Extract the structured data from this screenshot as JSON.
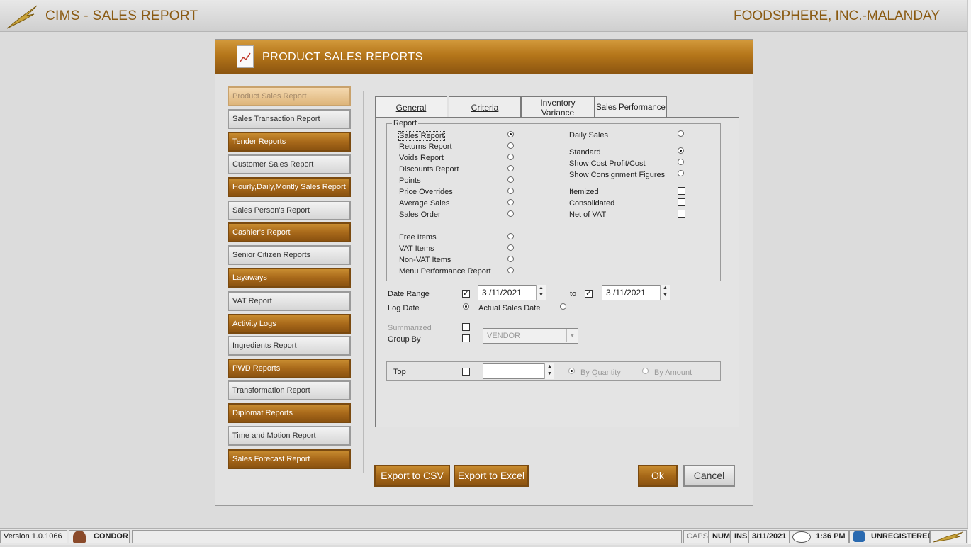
{
  "app": {
    "title": "CIMS - SALES REPORT",
    "company": "FOODSPHERE, INC.-MALANDAY"
  },
  "panel": {
    "title": "PRODUCT SALES REPORTS"
  },
  "sidebar": {
    "items": [
      {
        "label": "Product Sales Report"
      },
      {
        "label": "Sales Transaction Report"
      },
      {
        "label": "Tender Reports"
      },
      {
        "label": "Customer Sales Report"
      },
      {
        "label": "Hourly,Daily,Montly Sales Report"
      },
      {
        "label": "Sales Person's Report"
      },
      {
        "label": "Cashier's Report"
      },
      {
        "label": "Senior Citizen Reports"
      },
      {
        "label": "Layaways"
      },
      {
        "label": "VAT Report"
      },
      {
        "label": "Activity Logs"
      },
      {
        "label": "Ingredients Report"
      },
      {
        "label": "PWD Reports"
      },
      {
        "label": "Transformation Report"
      },
      {
        "label": "Diplomat Reports"
      },
      {
        "label": "Time and Motion Report"
      },
      {
        "label": "Sales Forecast Report"
      }
    ]
  },
  "tabs": [
    {
      "label": "General"
    },
    {
      "label": "Criteria"
    },
    {
      "label": "Inventory Variance"
    },
    {
      "label": "Sales Performance"
    }
  ],
  "general": {
    "group_label": "Report",
    "left_options": [
      {
        "label": "Sales Report",
        "selected": true
      },
      {
        "label": "Returns Report",
        "selected": false
      },
      {
        "label": "Voids Report",
        "selected": false
      },
      {
        "label": "Discounts Report",
        "selected": false
      },
      {
        "label": "Points",
        "selected": false
      },
      {
        "label": "Price Overrides",
        "selected": false
      },
      {
        "label": "Average Sales",
        "selected": false
      },
      {
        "label": "Sales Order",
        "selected": false
      },
      {
        "label": "Free Items",
        "selected": false
      },
      {
        "label": "VAT Items",
        "selected": false
      },
      {
        "label": "Non-VAT Items",
        "selected": false
      },
      {
        "label": "Menu Performance Report",
        "selected": false
      }
    ],
    "daily_sales": {
      "label": "Daily Sales",
      "selected": false
    },
    "view_options": [
      {
        "label": "Standard",
        "selected": true
      },
      {
        "label": "Show Cost Profit/Cost",
        "selected": false
      },
      {
        "label": "Show Consignment Figures",
        "selected": false
      }
    ],
    "check_options": [
      {
        "label": "Itemized",
        "checked": false
      },
      {
        "label": "Consolidated",
        "checked": false
      },
      {
        "label": "Net of VAT",
        "checked": false
      }
    ],
    "date_range": {
      "label": "Date Range",
      "from_checked": true,
      "from_value": "3 /11/2021",
      "to_label": "to",
      "to_checked": true,
      "to_value": "3 /11/2021"
    },
    "log_date": {
      "label": "Log Date",
      "selected": true
    },
    "actual_sales_date": {
      "label": "Actual Sales Date",
      "selected": false
    },
    "summarized": {
      "label": "Summarized",
      "checked": false
    },
    "group_by": {
      "label": "Group By",
      "checked": false,
      "value": "VENDOR"
    },
    "top": {
      "label": "Top",
      "checked": false,
      "value": "",
      "by_quantity": "By Quantity",
      "by_amount": "By Amount"
    }
  },
  "actions": {
    "export_csv": "Export to CSV",
    "export_excel": "Export to Excel",
    "ok": "Ok",
    "cancel": "Cancel"
  },
  "status": {
    "version": "Version 1.0.1066",
    "user": "CONDOR",
    "caps": "CAPS",
    "num": "NUM",
    "ins": "INS",
    "date": "3/11/2021",
    "time": "1:36 PM",
    "registration": "UNREGISTERED"
  },
  "colors": {
    "accent": "#a8691a",
    "title_text": "#8a5a12"
  }
}
